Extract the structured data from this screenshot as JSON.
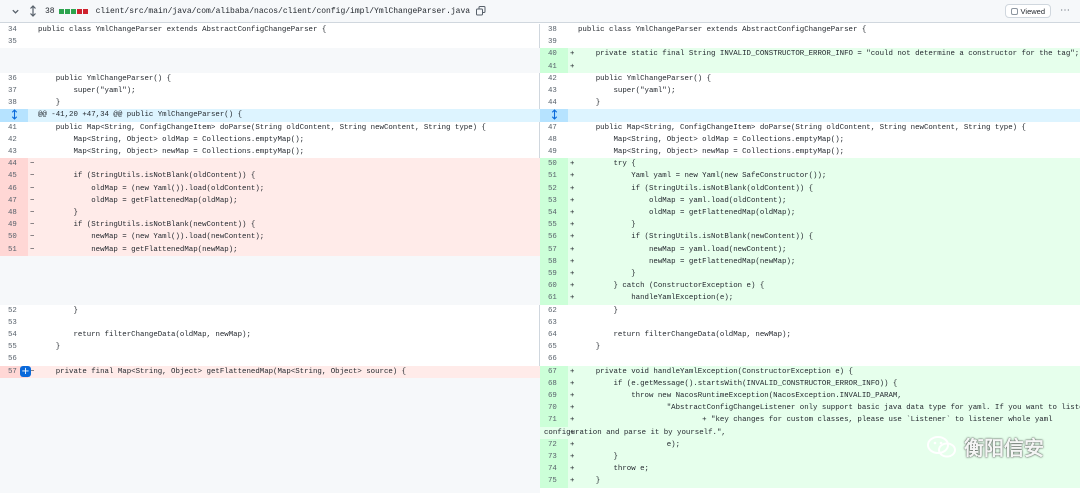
{
  "file_header": {
    "changes_count": "38",
    "bar_colors": [
      "#2da44e",
      "#2da44e",
      "#2da44e",
      "#cf222e",
      "#cf222e"
    ],
    "path": "client/src/main/java/com/alibaba/nacos/client/config/impl/YmlChangeParser.java",
    "viewed_label": "Viewed",
    "viewed_checked": false
  },
  "diff": {
    "hunk_header": "@@ -41,20 +47,34 @@ public YmlChangeParser() {",
    "left": [
      {
        "type": "ctx",
        "num": "34",
        "code": "public class YmlChangeParser extends AbstractConfigChangeParser {"
      },
      {
        "type": "ctx",
        "num": "35",
        "code": ""
      },
      {
        "type": "empty",
        "num": "",
        "code": ""
      },
      {
        "type": "empty",
        "num": "",
        "code": ""
      },
      {
        "type": "ctx",
        "num": "36",
        "code": "    public YmlChangeParser() {"
      },
      {
        "type": "ctx",
        "num": "37",
        "code": "        super(\"yaml\");"
      },
      {
        "type": "ctx",
        "num": "38",
        "code": "    }"
      },
      {
        "type": "hunk",
        "num": "",
        "code": ""
      },
      {
        "type": "ctx",
        "num": "41",
        "code": "    public Map<String, ConfigChangeItem> doParse(String oldContent, String newContent, String type) {"
      },
      {
        "type": "ctx",
        "num": "42",
        "code": "        Map<String, Object> oldMap = Collections.emptyMap();"
      },
      {
        "type": "ctx",
        "num": "43",
        "code": "        Map<String, Object> newMap = Collections.emptyMap();"
      },
      {
        "type": "del",
        "num": "44",
        "code": ""
      },
      {
        "type": "del",
        "num": "45",
        "code": "        if (StringUtils.isNotBlank(oldContent)) {"
      },
      {
        "type": "del",
        "num": "46",
        "code": "            oldMap = (new Yaml()).load(oldContent);"
      },
      {
        "type": "del",
        "num": "47",
        "code": "            oldMap = getFlattenedMap(oldMap);"
      },
      {
        "type": "del",
        "num": "48",
        "code": "        }"
      },
      {
        "type": "del",
        "num": "49",
        "code": "        if (StringUtils.isNotBlank(newContent)) {"
      },
      {
        "type": "del",
        "num": "50",
        "code": "            newMap = (new Yaml()).load(newContent);"
      },
      {
        "type": "del",
        "num": "51",
        "code": "            newMap = getFlattenedMap(newMap);"
      },
      {
        "type": "empty",
        "num": "",
        "code": ""
      },
      {
        "type": "empty",
        "num": "",
        "code": ""
      },
      {
        "type": "empty",
        "num": "",
        "code": ""
      },
      {
        "type": "empty",
        "num": "",
        "code": ""
      },
      {
        "type": "ctx",
        "num": "52",
        "code": "        }"
      },
      {
        "type": "ctx",
        "num": "53",
        "code": ""
      },
      {
        "type": "ctx",
        "num": "54",
        "code": "        return filterChangeData(oldMap, newMap);"
      },
      {
        "type": "ctx",
        "num": "55",
        "code": "    }"
      },
      {
        "type": "ctx",
        "num": "56",
        "code": ""
      },
      {
        "type": "del",
        "num": "57",
        "code": "    private final Map<String, Object> getFlattenedMap(Map<String, Object> source) {"
      },
      {
        "type": "empty",
        "num": "",
        "code": ""
      },
      {
        "type": "empty",
        "num": "",
        "code": ""
      },
      {
        "type": "empty",
        "num": "",
        "code": ""
      },
      {
        "type": "empty",
        "num": "",
        "code": ""
      },
      {
        "type": "empty",
        "num": "",
        "code": ""
      },
      {
        "type": "empty",
        "num": "",
        "code": ""
      },
      {
        "type": "empty",
        "num": "",
        "code": ""
      },
      {
        "type": "empty",
        "num": "",
        "code": ""
      },
      {
        "type": "empty",
        "num": "",
        "code": ""
      },
      {
        "type": "empty",
        "num": "",
        "code": ""
      }
    ],
    "right": [
      {
        "type": "ctx",
        "num": "38",
        "code": "public class YmlChangeParser extends AbstractConfigChangeParser {"
      },
      {
        "type": "ctx",
        "num": "39",
        "code": ""
      },
      {
        "type": "add",
        "num": "40",
        "code": "    private static final String INVALID_CONSTRUCTOR_ERROR_INFO = \"could not determine a constructor for the tag\";"
      },
      {
        "type": "add",
        "num": "41",
        "code": ""
      },
      {
        "type": "ctx",
        "num": "42",
        "code": "    public YmlChangeParser() {"
      },
      {
        "type": "ctx",
        "num": "43",
        "code": "        super(\"yaml\");"
      },
      {
        "type": "ctx",
        "num": "44",
        "code": "    }"
      },
      {
        "type": "hunk",
        "num": "",
        "code": ""
      },
      {
        "type": "ctx",
        "num": "47",
        "code": "    public Map<String, ConfigChangeItem> doParse(String oldContent, String newContent, String type) {"
      },
      {
        "type": "ctx",
        "num": "48",
        "code": "        Map<String, Object> oldMap = Collections.emptyMap();"
      },
      {
        "type": "ctx",
        "num": "49",
        "code": "        Map<String, Object> newMap = Collections.emptyMap();"
      },
      {
        "type": "add",
        "num": "50",
        "code": "        try {"
      },
      {
        "type": "add",
        "num": "51",
        "code": "            Yaml yaml = new Yaml(new SafeConstructor());"
      },
      {
        "type": "add",
        "num": "52",
        "code": "            if (StringUtils.isNotBlank(oldContent)) {"
      },
      {
        "type": "add",
        "num": "53",
        "code": "                oldMap = yaml.load(oldContent);"
      },
      {
        "type": "add",
        "num": "54",
        "code": "                oldMap = getFlattenedMap(oldMap);"
      },
      {
        "type": "add",
        "num": "55",
        "code": "            }"
      },
      {
        "type": "add",
        "num": "56",
        "code": "            if (StringUtils.isNotBlank(newContent)) {"
      },
      {
        "type": "add",
        "num": "57",
        "code": "                newMap = yaml.load(newContent);"
      },
      {
        "type": "add",
        "num": "58",
        "code": "                newMap = getFlattenedMap(newMap);"
      },
      {
        "type": "add",
        "num": "59",
        "code": "            }"
      },
      {
        "type": "add",
        "num": "60",
        "code": "        } catch (ConstructorException e) {"
      },
      {
        "type": "add",
        "num": "61",
        "code": "            handleYamlException(e);"
      },
      {
        "type": "ctx",
        "num": "62",
        "code": "        }"
      },
      {
        "type": "ctx",
        "num": "63",
        "code": ""
      },
      {
        "type": "ctx",
        "num": "64",
        "code": "        return filterChangeData(oldMap, newMap);"
      },
      {
        "type": "ctx",
        "num": "65",
        "code": "    }"
      },
      {
        "type": "ctx",
        "num": "66",
        "code": ""
      },
      {
        "type": "add",
        "num": "67",
        "code": "    private void handleYamlException(ConstructorException e) {"
      },
      {
        "type": "add",
        "num": "68",
        "code": "        if (e.getMessage().startsWith(INVALID_CONSTRUCTOR_ERROR_INFO)) {"
      },
      {
        "type": "add",
        "num": "69",
        "code": "            throw new NacosRuntimeException(NacosException.INVALID_PARAM,"
      },
      {
        "type": "add",
        "num": "70",
        "code": "                    \"AbstractConfigChangeListener only support basic java data type for yaml. If you want to listen \""
      },
      {
        "type": "add",
        "num": "71",
        "code": "                            + \"key changes for custom classes, please use `Listener` to listener whole yaml"
      },
      {
        "type": "addwrap",
        "num": "",
        "code": "configuration and parse it by yourself.\","
      },
      {
        "type": "add",
        "num": "72",
        "code": "                    e);"
      },
      {
        "type": "add",
        "num": "73",
        "code": "        }"
      },
      {
        "type": "add",
        "num": "74",
        "code": "        throw e;"
      },
      {
        "type": "add",
        "num": "75",
        "code": "    }"
      }
    ]
  },
  "watermark": {
    "text": "衡阳信安"
  }
}
